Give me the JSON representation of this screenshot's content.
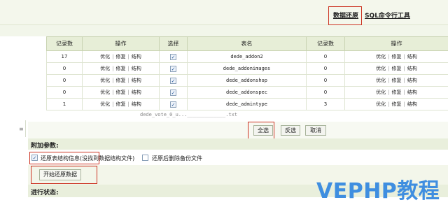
{
  "topbar": {
    "restore_label": "数据还原",
    "separator": "|",
    "sql_tool_label": "SQL命令行工具"
  },
  "table": {
    "headers": [
      "记录数",
      "操作",
      "选择",
      "表名",
      "记录数",
      "操作"
    ],
    "ops": [
      "优化",
      "修复",
      "结构"
    ],
    "rows": [
      {
        "count_left": "17",
        "table_name": "dede_addon2",
        "count_right": "0"
      },
      {
        "count_left": "0",
        "table_name": "dede_addonimages",
        "count_right": "0"
      },
      {
        "count_left": "0",
        "table_name": "dede_addonshop",
        "count_right": "0"
      },
      {
        "count_left": "0",
        "table_name": "dede_addonspec",
        "count_right": "0"
      },
      {
        "count_left": "1",
        "table_name": "dede_admintype",
        "count_right": "3"
      }
    ]
  },
  "partial_row_text": "dede_vote_0_u..._____________.txt",
  "buttons": {
    "select_all": "全选",
    "invert": "反选",
    "cancel": "取消"
  },
  "gutter_glyph": "≡",
  "additional_params_label": "附加参数:",
  "options": {
    "restore_structure": "还原表结构信息(没找到数据结构文件)",
    "delete_backup": "还原后删除备份文件"
  },
  "start_button": "开始还原数据",
  "progress_label": "进行状态:",
  "watermark": "VEPHP教程",
  "colors": {
    "highlight_red": "#cc3322",
    "header_green": "#e7eed7",
    "watermark_blue": "#3f8ee0"
  }
}
